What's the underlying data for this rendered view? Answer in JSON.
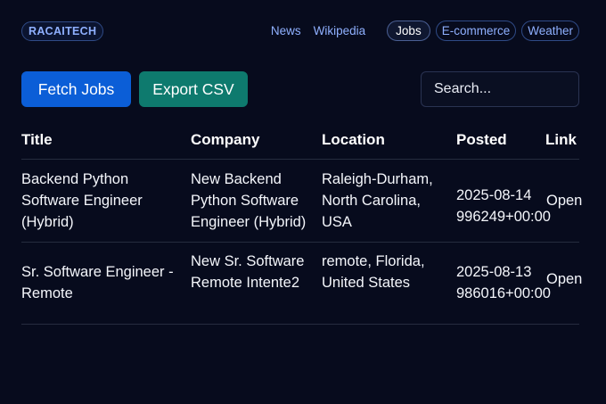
{
  "header": {
    "logo": "RACAITECH",
    "nav": [
      {
        "label": "News"
      },
      {
        "label": "Wikipedia"
      },
      {
        "label": "Jobs"
      },
      {
        "label": "E-commerce"
      },
      {
        "label": "Weather"
      }
    ]
  },
  "toolbar": {
    "fetch_label": "Fetch Jobs",
    "export_label": "Export CSV",
    "search_placeholder": "Search..."
  },
  "table": {
    "columns": [
      "Title",
      "Company",
      "Location",
      "Posted",
      "Link"
    ],
    "rows": [
      {
        "title": "Backend Python Software Engineer (Hybrid)",
        "company": "New Backend Python Software Engineer (Hybrid)",
        "location": "Raleigh-Durham, North Carolina, USA",
        "posted_date": "2025-08-14",
        "posted_time": "996249+00:00",
        "link": "Open"
      },
      {
        "title": "Sr. Software Engineer - Remote",
        "company": "New Sr. Software Remote Intente2",
        "location": "remote, Florida, United States",
        "posted_date": "2025-08-13",
        "posted_time": "986016+00:00",
        "link": "Open"
      }
    ]
  },
  "colors": {
    "background": "#070b1d",
    "fetch_button": "#0b5ed7",
    "export_button": "#0e7a6e",
    "nav_link": "#8fb0ff"
  }
}
